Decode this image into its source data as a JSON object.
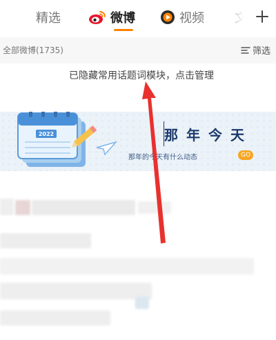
{
  "tabs": [
    {
      "label": "精选",
      "active": false
    },
    {
      "label": "微博",
      "active": true
    },
    {
      "label": "视频",
      "active": false
    },
    {
      "label": "文",
      "active": false
    }
  ],
  "add_icon": "plus-icon",
  "filter_bar": {
    "all_label": "全部微博(1735)",
    "filter_label": "筛选",
    "filter_icon": "filter-icon"
  },
  "hidden_notice": "已隐藏常用话题词模块，点击管理",
  "banner": {
    "title": "那年今天",
    "subtitle": "那年的今天有什么动态",
    "go_label": "GO",
    "calendar_year": "2022"
  },
  "colors": {
    "accent": "#ff8200",
    "annotation": "#e8312f",
    "banner_bg": "#ebf2f8",
    "banner_text": "#1b3a6b"
  }
}
